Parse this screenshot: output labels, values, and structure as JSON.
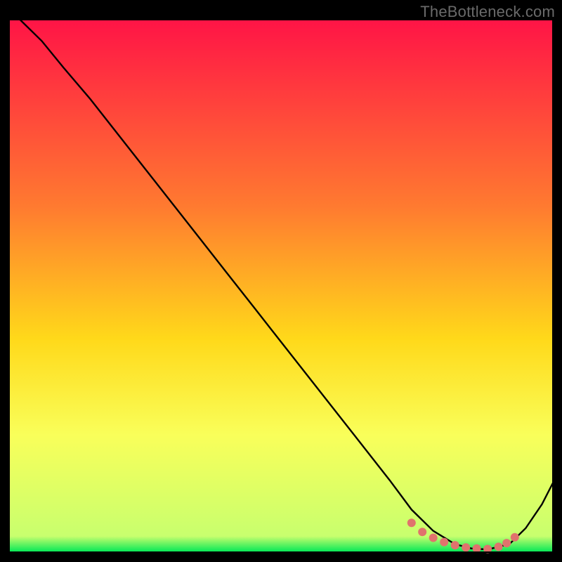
{
  "watermark": "TheBottleneck.com",
  "colors": {
    "gradient_top": "#ff1446",
    "gradient_mid1": "#ff7a30",
    "gradient_mid2": "#ffd91a",
    "gradient_mid3": "#f9ff5a",
    "gradient_bottom": "#00e756",
    "curve": "#000000",
    "marker": "#e0736d",
    "frame": "#000000"
  },
  "chart_data": {
    "type": "line",
    "title": "",
    "xlabel": "",
    "ylabel": "",
    "xlim": [
      0,
      100
    ],
    "ylim": [
      0,
      100
    ],
    "grid": false,
    "legend": false,
    "series": [
      {
        "name": "bottleneck-curve",
        "x": [
          2,
          6,
          10,
          15,
          20,
          25,
          30,
          35,
          40,
          45,
          50,
          55,
          60,
          65,
          70,
          74,
          78,
          82,
          85,
          88,
          92,
          95,
          98,
          100
        ],
        "y": [
          100,
          96,
          91,
          85,
          78.5,
          72,
          65.5,
          59,
          52.5,
          46,
          39.5,
          33,
          26.5,
          20,
          13.5,
          8,
          4,
          1.5,
          0.7,
          0.5,
          1.5,
          4.5,
          9,
          13
        ]
      }
    ],
    "markers": {
      "name": "optimal-range-dots",
      "x": [
        74,
        76,
        78,
        80,
        82,
        84,
        86,
        88,
        90,
        91.5,
        93
      ],
      "y": [
        5.5,
        3.8,
        2.7,
        1.9,
        1.3,
        0.9,
        0.7,
        0.6,
        1.0,
        1.7,
        2.8
      ]
    },
    "background_gradient": {
      "orientation": "vertical",
      "stops": [
        {
          "offset": 0.0,
          "color": "#ff1446"
        },
        {
          "offset": 0.35,
          "color": "#ff7a30"
        },
        {
          "offset": 0.6,
          "color": "#ffd91a"
        },
        {
          "offset": 0.78,
          "color": "#f9ff5a"
        },
        {
          "offset": 0.97,
          "color": "#c8ff6e"
        },
        {
          "offset": 1.0,
          "color": "#00e756"
        }
      ]
    }
  }
}
